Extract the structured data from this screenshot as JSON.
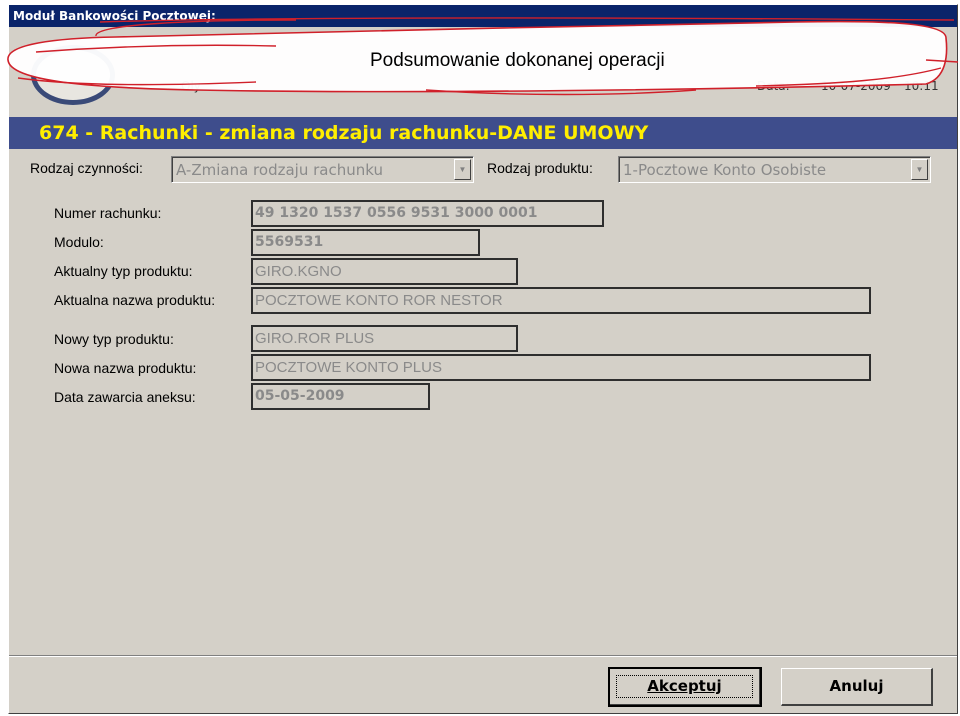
{
  "window": {
    "title": "Moduł Bankowości Pocztowej:"
  },
  "callout": {
    "title": "Podsumowanie dokonanej operacji"
  },
  "background_header": {
    "left_fragment": "Oly",
    "right_fragment": "Data:",
    "date_fragment": "10-07-2009",
    "time_fragment": "10:11"
  },
  "banner": {
    "title": "674 - Rachunki - zmiana rodzaju rachunku-DANE UMOWY"
  },
  "selectors": {
    "activity_label": "Rodzaj czynności:",
    "activity_value": "A-Zmiana rodzaju rachunku",
    "product_label": "Rodzaj produktu:",
    "product_value": "1-Pocztowe Konto Osobiste"
  },
  "form": {
    "fields": [
      {
        "label": "Numer rachunku:",
        "value": "49 1320 1537 0556 9531 3000 0001"
      },
      {
        "label": "Modulo:",
        "value": "5569531"
      },
      {
        "label": "Aktualny typ produktu:",
        "value": "GIRO.KGNO"
      },
      {
        "label": "Aktualna nazwa produktu:",
        "value": "POCZTOWE KONTO ROR NESTOR"
      },
      {
        "label": "Nowy typ produktu:",
        "value": "GIRO.ROR PLUS"
      },
      {
        "label": "Nowa nazwa produktu:",
        "value": "POCZTOWE KONTO PLUS"
      },
      {
        "label": "Data zawarcia aneksu:",
        "value": "05-05-2009"
      }
    ]
  },
  "buttons": {
    "accept": "Akceptuj",
    "cancel": "Anuluj"
  },
  "icons": {
    "combo_arrow": "chevron-down-icon"
  },
  "colors": {
    "titlebar": "#0a246a",
    "banner_bg": "#3e4d8c",
    "banner_text": "#ffee00",
    "window_bg": "#d4d0c8",
    "callout_stroke": "#d0202a"
  }
}
